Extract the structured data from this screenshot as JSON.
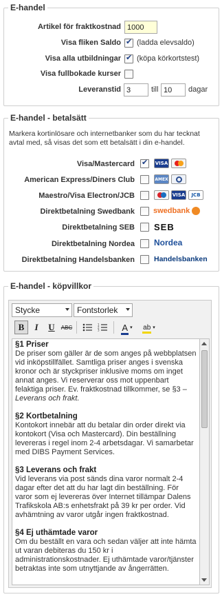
{
  "ehandel": {
    "legend": "E-handel",
    "fraktkostnad_label": "Artikel för fraktkostnad",
    "fraktkostnad_value": "1000",
    "saldo_label": "Visa fliken Saldo",
    "saldo_checked": true,
    "saldo_note": "(ladda elevsaldo)",
    "utbildningar_label": "Visa alla utbildningar",
    "utbildningar_checked": true,
    "utbildningar_note": "(köpa körkortstest)",
    "fullbokade_label": "Visa fullbokade kurser",
    "fullbokade_checked": false,
    "leveranstid_label": "Leveranstid",
    "leveranstid_from": "3",
    "till_label": "till",
    "leveranstid_to": "10",
    "dagar_label": "dagar"
  },
  "betalsatt": {
    "legend": "E-handel - betalsätt",
    "description": "Markera kortinlösare och internetbanker som du har tecknat avtal med, så visas det som ett betalsätt i din e-handel.",
    "methods": [
      {
        "label": "Visa/Mastercard",
        "checked": true,
        "logos": [
          "VISA",
          "MC"
        ]
      },
      {
        "label": "American Express/Diners Club",
        "checked": false,
        "logos": [
          "AMEX",
          "DC"
        ]
      },
      {
        "label": "Maestro/Visa Electron/JCB",
        "checked": false,
        "logos": [
          "MAESTRO",
          "VISA",
          "JCB"
        ]
      },
      {
        "label": "Direktbetalning Swedbank",
        "checked": false,
        "logos": [
          "swedbank"
        ]
      },
      {
        "label": "Direktbetalning SEB",
        "checked": false,
        "logos": [
          "SEB"
        ]
      },
      {
        "label": "Direktbetalning Nordea",
        "checked": false,
        "logos": [
          "Nordea"
        ]
      },
      {
        "label": "Direktbetalning Handelsbanken",
        "checked": false,
        "logos": [
          "Handelsbanken"
        ]
      }
    ]
  },
  "kopvillkor": {
    "legend": "E-handel - köpvillkor",
    "style_select": "Stycke",
    "size_select": "Fontstorlek",
    "toolbar": {
      "bold": "B",
      "italic": "I",
      "underline": "U",
      "strike": "ABC",
      "font_color": "A",
      "highlight": "ab"
    },
    "sections": [
      {
        "heading": "§1 Priser",
        "body": "De priser som gäller är de som anges på webbplatsen vid inköpstillfället. Samtliga priser anges i svenska kronor och är styckpriser inklusive moms om inget annat anges. Vi reserverar oss mot uppenbart felaktiga priser. Ev. fraktkostnad tillkommer, se §3 – ",
        "italic": "Leverans och frakt."
      },
      {
        "heading": "§2 Kortbetalning",
        "body": "Kontokort innebär att du betalar din order direkt via kontokort (Visa och Mastercard). Din beställning levereras i regel inom 2-4 arbetsdagar. Vi samarbetar med DIBS Payment Services.",
        "italic": ""
      },
      {
        "heading": "§3 Leverans och frakt",
        "body": "Vid leverans via post sänds dina varor normalt 2-4 dagar efter det att du har lagt din beställning. För varor som ej levereras över Internet tillämpar Dalens Trafikskola AB:s enhetsfrakt på 39 kr per order. Vid avhämtning av varor utgår ingen fraktkostnad.",
        "italic": ""
      },
      {
        "heading": "§4 Ej uthämtade varor",
        "body": "Om du beställt en vara och sedan väljer att inte hämta ut varan debiteras du 150 kr i administrationskostnader. Ej uthämtade varor/tjänster betraktas inte som utnyttjande av ångerrätten.",
        "italic": ""
      }
    ]
  }
}
